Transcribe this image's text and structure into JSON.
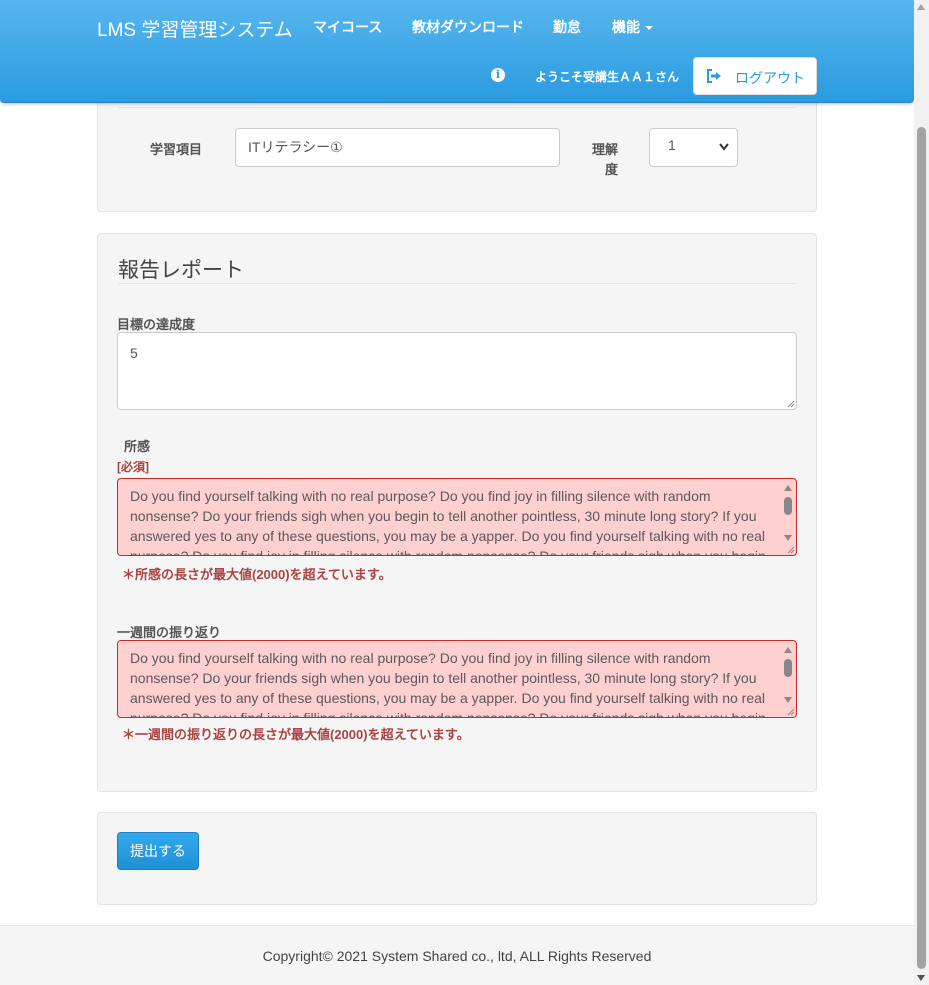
{
  "navbar": {
    "brand": "LMS 学習管理システム",
    "links": [
      "マイコース",
      "教材ダウンロード",
      "勤怠",
      "機能"
    ],
    "welcome": "ようこそ受講生ＡＡ１さん",
    "logout_label": "ログアウト",
    "accent_color": "#2a9be0"
  },
  "study_item": {
    "label": "学習項目",
    "value": "ITリテラシー①",
    "understanding_label_1": "理解",
    "understanding_label_2": "度",
    "understanding_value": "1"
  },
  "report": {
    "title": "報告レポート",
    "goal_label": "目標の達成度",
    "goal_value": "5",
    "impression_label": "所感",
    "required_tag": "[必須]",
    "impression_value": "Do you find yourself talking with no real purpose? Do you find joy in filling silence with random nonsense? Do your friends sigh when you begin to tell another pointless, 30 minute long story? If you answered yes to any of these questions, you may be a yapper. Do you find yourself talking with no real purpose? Do you find joy in filling silence with random nonsense? Do your friends sigh when you begin",
    "impression_error": "＊所感の長さが最大値(2000)を超えています。",
    "weekly_label": "一週間の振り返り",
    "weekly_value": "Do you find yourself talking with no real purpose? Do you find joy in filling silence with random nonsense? Do your friends sigh when you begin to tell another pointless, 30 minute long story? If you answered yes to any of these questions, you may be a yapper. Do you find yourself talking with no real purpose? Do you find joy in filling silence with random nonsense? Do your friends sigh when you begin",
    "weekly_error": "＊一週間の振り返りの長さが最大値(2000)を超えています。",
    "error_color": "#a94442"
  },
  "submit_label": "提出する",
  "footer": "Copyright© 2021 System Shared co., ltd, ALL Rights Reserved"
}
